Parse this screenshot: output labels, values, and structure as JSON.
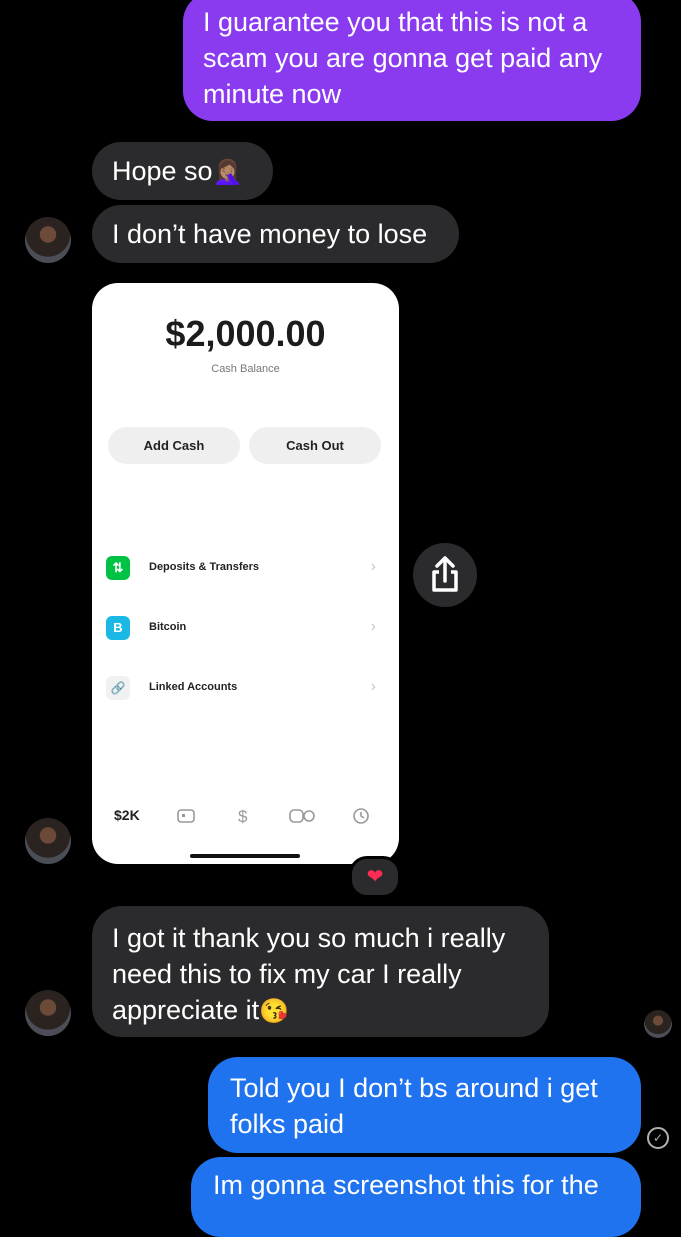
{
  "messages": {
    "sent_1": "I guarantee you that this is not a scam you are gonna get paid any minute now",
    "recv_1_text": "Hope so",
    "recv_1_emoji": "🤦🏽‍♀️",
    "recv_2": "I don’t have money to lose",
    "recv_3_text": "I got it thank you so much i really need this to fix my car I really appreciate it",
    "recv_3_emoji": "😘",
    "sent_2": "Told you I don’t bs around i get folks paid",
    "sent_3": "Im gonna screenshot this for the"
  },
  "screenshot": {
    "balance": "$2,000.00",
    "balance_caption": "Cash Balance",
    "add_cash": "Add Cash",
    "cash_out": "Cash Out",
    "rows": [
      {
        "label": "Deposits & Transfers",
        "icon": "⇅"
      },
      {
        "label": "Bitcoin",
        "icon": "B"
      },
      {
        "label": "Linked Accounts",
        "icon": "🔗"
      }
    ],
    "tab_balance": "$2K",
    "tab_dollar": "$"
  },
  "reaction": "❤",
  "colors": {
    "sent_purple": "#8a3bf0",
    "sent_blue": "#1f73ef",
    "received": "#2b2b2d",
    "deposits_green": "#00c244",
    "bitcoin_cyan": "#1bb8e6"
  }
}
